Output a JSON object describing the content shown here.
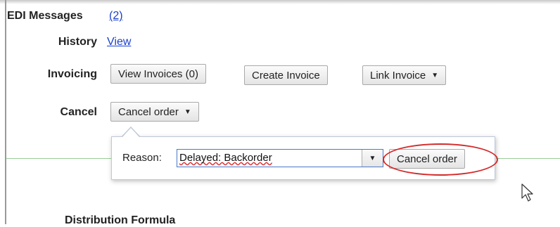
{
  "edi": {
    "label": "EDI Messages",
    "count_link": "(2)"
  },
  "history": {
    "label": "History",
    "link": "View"
  },
  "invoicing": {
    "label": "Invoicing",
    "view_invoices": "View Invoices (0)",
    "create_invoice": "Create Invoice",
    "link_invoice": "Link Invoice"
  },
  "cancel": {
    "label": "Cancel",
    "dropdown_label": "Cancel order"
  },
  "popover": {
    "reason_label": "Reason:",
    "reason_value": "Delayed: Backorder",
    "submit_label": "Cancel order"
  },
  "section": {
    "heading": "Distribution Formula"
  },
  "colors": {
    "link": "#1a3fcc",
    "highlight": "#d42a2a",
    "divider": "#99cc99"
  },
  "icons": {
    "caret": "caret-down-icon",
    "pointer": "mouse-pointer-icon"
  }
}
